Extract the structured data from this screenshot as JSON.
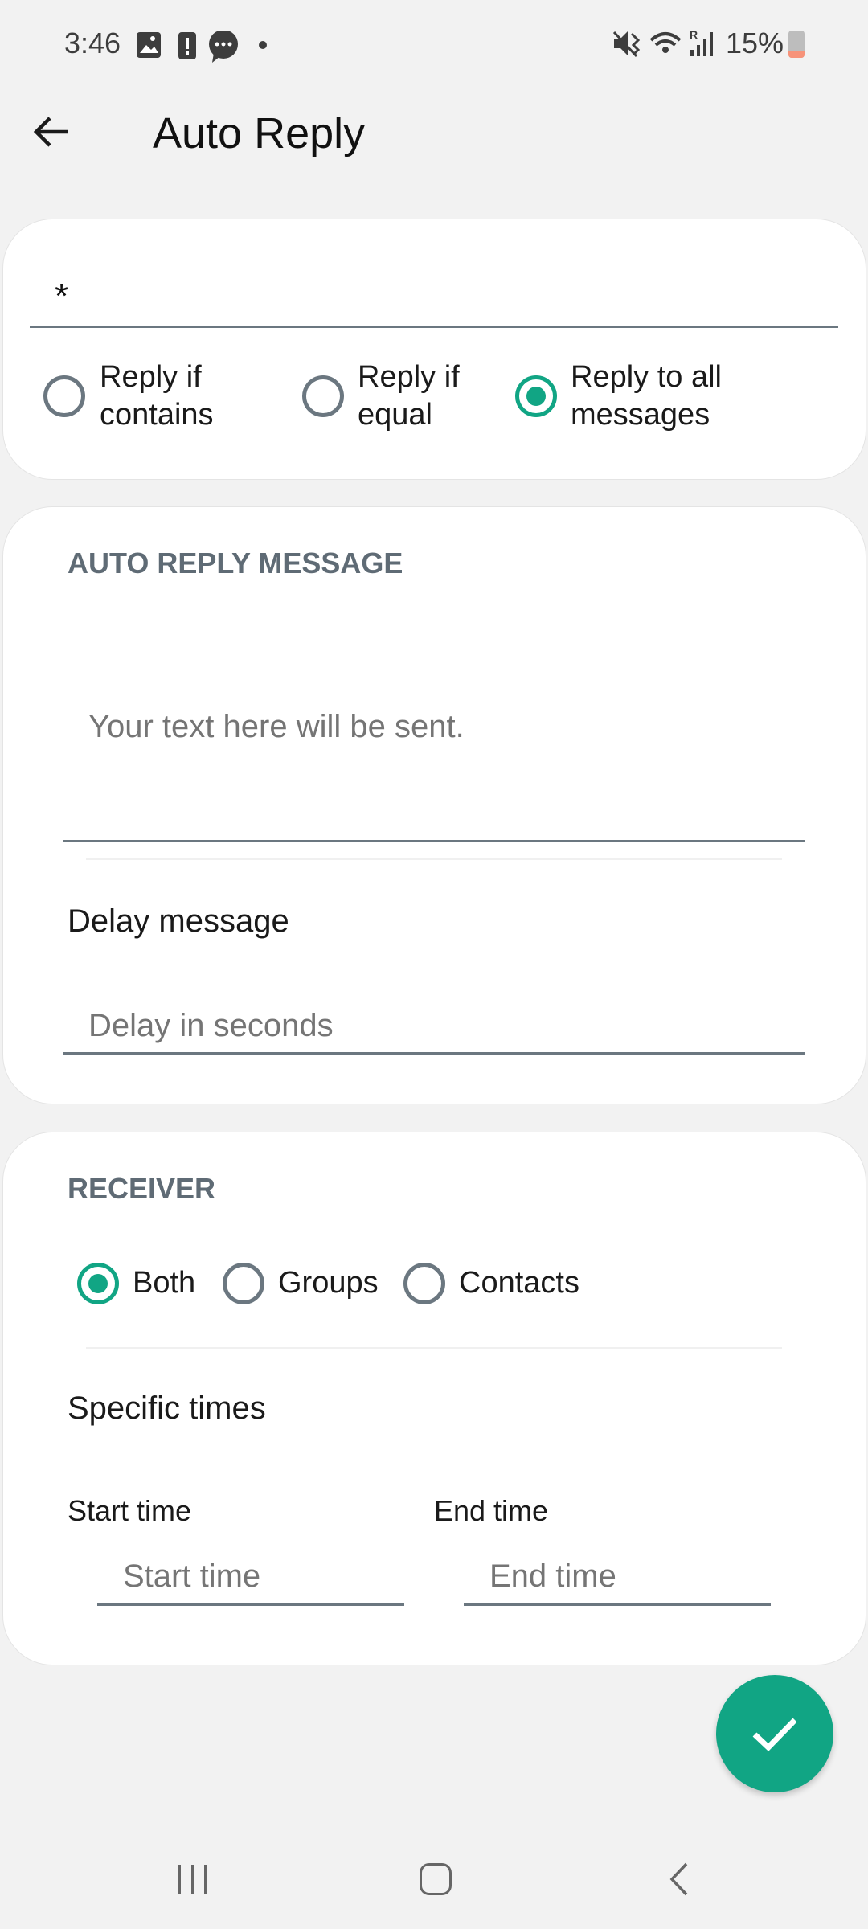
{
  "status_bar": {
    "time": "3:46",
    "battery": "15%",
    "icons": [
      "gallery-icon",
      "battery-alert-icon",
      "chat-icon",
      "dot-icon",
      "mute-icon",
      "wifi-icon",
      "signal-roaming-icon",
      "battery-low-icon"
    ]
  },
  "header": {
    "title": "Auto Reply",
    "back_icon": "arrow-left-icon"
  },
  "keyword": {
    "value": "*",
    "options": [
      {
        "label": "Reply if\ncontains",
        "checked": false
      },
      {
        "label": "Reply if\nequal",
        "checked": false
      },
      {
        "label": "Reply to all\nmessages",
        "checked": true
      }
    ]
  },
  "message": {
    "header": "AUTO REPLY MESSAGE",
    "placeholder": "Your text here will be sent.",
    "delay_label": "Delay message",
    "delay_placeholder": "Delay in seconds"
  },
  "receiver": {
    "header": "RECEIVER",
    "options": [
      {
        "label": "Both",
        "checked": true
      },
      {
        "label": "Groups",
        "checked": false
      },
      {
        "label": "Contacts",
        "checked": false
      }
    ],
    "specific_times": "Specific times",
    "start_label": "Start time",
    "end_label": "End time",
    "start_placeholder": "Start time",
    "end_placeholder": "End time"
  },
  "fab": {
    "icon": "check-icon",
    "color": "#11a584"
  },
  "nav": {
    "icons": [
      "recents-icon",
      "home-icon",
      "back-icon"
    ]
  },
  "colors": {
    "accent": "#11a584",
    "header_text": "#5f6b75",
    "background": "#f2f2f2"
  }
}
